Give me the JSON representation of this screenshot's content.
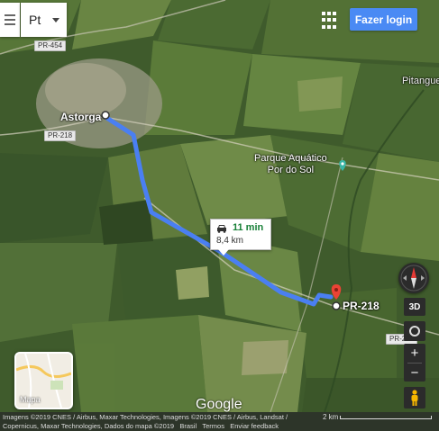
{
  "ui": {
    "language": "Pt",
    "login_label": "Fazer login"
  },
  "places": {
    "origin": "Astorga",
    "town": "Pitangue",
    "poi_line1": "Parque Aquático",
    "poi_line2": "Por do Sol",
    "destination": "PR-218"
  },
  "roads": {
    "r454": "PR-454",
    "r218_top": "PR-218",
    "r218_bottom": "PR-218"
  },
  "route": {
    "time": "11 min",
    "distance": "8,4 km",
    "color": "#4a7ff2"
  },
  "controls": {
    "label_3d": "3D",
    "zoom_in": "+",
    "zoom_out": "−"
  },
  "thumbnail": {
    "label": "Mapa"
  },
  "brand": "Google",
  "footer": {
    "attribution": "Imagens ©2019 CNES / Airbus, Maxar Technologies, Imagens ©2019 CNES / Airbus, Landsat / Copernicus, Maxar Technologies, Dados do mapa ©2019",
    "country": "Brasil",
    "terms": "Termos",
    "feedback": "Enviar feedback",
    "scale": "2 km"
  }
}
